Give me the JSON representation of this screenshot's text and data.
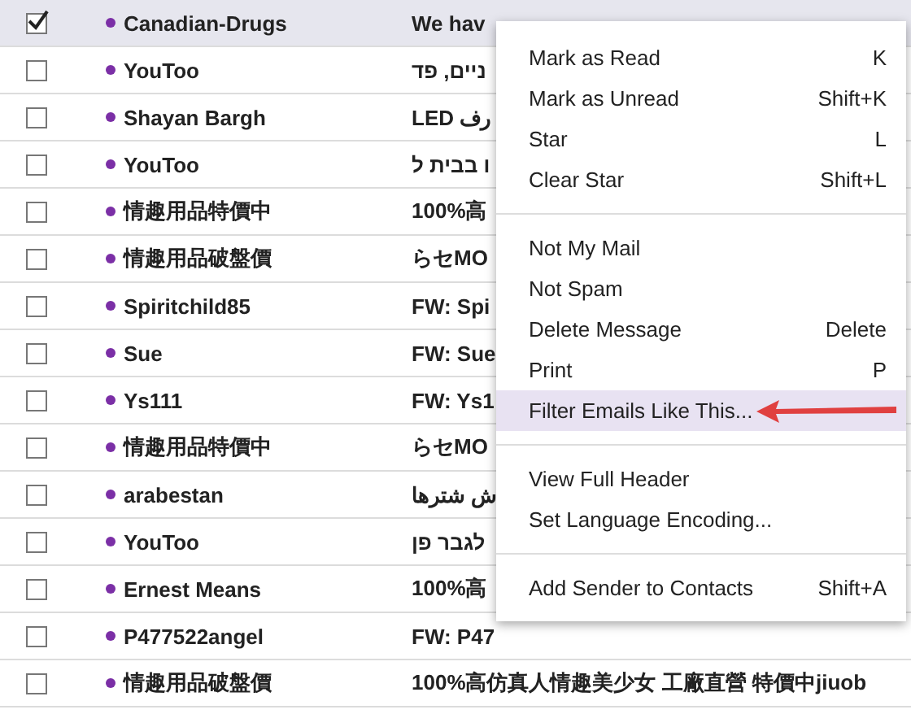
{
  "messages": [
    {
      "sender": "Canadian-Drugs",
      "subject": "We hav",
      "checked": true,
      "selected": true,
      "unread": true
    },
    {
      "sender": "YouToo",
      "subject": "ניים, פד",
      "checked": false,
      "selected": false,
      "unread": true
    },
    {
      "sender": "Shayan Bargh",
      "subject": "LED رف",
      "checked": false,
      "selected": false,
      "unread": true
    },
    {
      "sender": "YouToo",
      "subject": "ו בבית ל",
      "checked": false,
      "selected": false,
      "unread": true
    },
    {
      "sender": "情趣用品特價中",
      "subject": "100%高",
      "checked": false,
      "selected": false,
      "unread": true
    },
    {
      "sender": "情趣用品破盤價",
      "subject": "らセMO",
      "checked": false,
      "selected": false,
      "unread": true
    },
    {
      "sender": "Spiritchild85",
      "subject": "FW: Spi",
      "checked": false,
      "selected": false,
      "unread": true
    },
    {
      "sender": "Sue",
      "subject": "FW: Sue",
      "checked": false,
      "selected": false,
      "unread": true
    },
    {
      "sender": "Ys111",
      "subject": "FW: Ys1",
      "checked": false,
      "selected": false,
      "unread": true
    },
    {
      "sender": "情趣用品特價中",
      "subject": "らセMO",
      "checked": false,
      "selected": false,
      "unread": true
    },
    {
      "sender": "arabestan",
      "subject": "ش شترها",
      "checked": false,
      "selected": false,
      "unread": true
    },
    {
      "sender": "YouToo",
      "subject": "לגבר פן",
      "checked": false,
      "selected": false,
      "unread": true
    },
    {
      "sender": "Ernest Means",
      "subject": "100%高",
      "checked": false,
      "selected": false,
      "unread": true
    },
    {
      "sender": "P477522angel",
      "subject": "FW: P47",
      "checked": false,
      "selected": false,
      "unread": true
    },
    {
      "sender": "情趣用品破盤價",
      "subject": "100%高仿真人情趣美少女 工廠直營 特價中jiuob",
      "checked": false,
      "selected": false,
      "unread": true
    }
  ],
  "context_menu": {
    "groups": [
      [
        {
          "label": "Mark as Read",
          "shortcut": "K",
          "selected": false
        },
        {
          "label": "Mark as Unread",
          "shortcut": "Shift+K",
          "selected": false
        },
        {
          "label": "Star",
          "shortcut": "L",
          "selected": false
        },
        {
          "label": "Clear Star",
          "shortcut": "Shift+L",
          "selected": false
        }
      ],
      [
        {
          "label": "Not My Mail",
          "selected": false
        },
        {
          "label": "Not Spam",
          "selected": false
        },
        {
          "label": "Delete Message",
          "shortcut": "Delete",
          "selected": false
        },
        {
          "label": "Print",
          "shortcut": "P",
          "selected": false
        },
        {
          "label": "Filter Emails Like This...",
          "selected": true,
          "annotated": true
        }
      ],
      [
        {
          "label": "View Full Header",
          "selected": false
        },
        {
          "label": "Set Language Encoding...",
          "selected": false
        }
      ],
      [
        {
          "label": "Add Sender to Contacts",
          "shortcut": "Shift+A",
          "selected": false
        }
      ]
    ]
  }
}
